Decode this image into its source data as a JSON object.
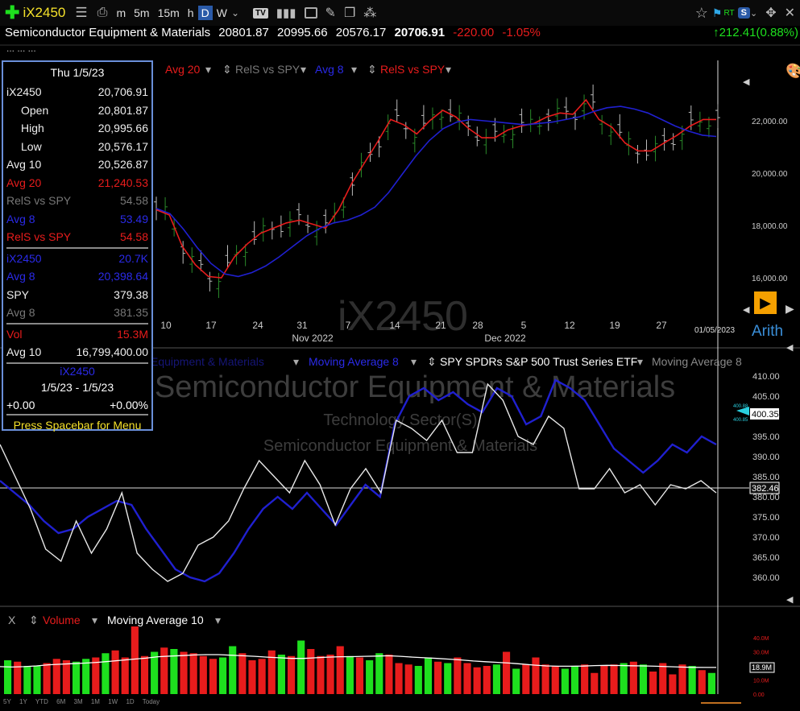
{
  "toolbar": {
    "symbol": "iX2450",
    "periods": [
      "m",
      "5m",
      "15m",
      "h",
      "D",
      "W"
    ],
    "selected": "D"
  },
  "header": {
    "name": "Semiconductor Equipment & Materials",
    "open": "20801.87",
    "high": "20995.66",
    "low": "20576.17",
    "close": "20706.91",
    "change": "-220.00",
    "change_pct": "-1.05%",
    "right_change": "212.41",
    "right_pct": "(0.88%)",
    "rt": "RT",
    "s_badge": "S"
  },
  "dots": "... ... ...",
  "panel": {
    "date": "Thu 1/5/23",
    "rows": [
      {
        "label": "iX2450",
        "value": "20,706.91",
        "color": "white"
      },
      {
        "label": "Open",
        "value": "20,801.87",
        "color": "white",
        "indent": true
      },
      {
        "label": "High",
        "value": "20,995.66",
        "color": "white",
        "indent": true
      },
      {
        "label": "Low",
        "value": "20,576.17",
        "color": "white",
        "indent": true
      },
      {
        "label": "Avg 10",
        "value": "20,526.87",
        "color": "white"
      },
      {
        "label": "Avg 20",
        "value": "21,240.53",
        "color": "red"
      },
      {
        "label": "RelS vs SPY",
        "value": "54.58",
        "color": "gray"
      },
      {
        "label": "Avg 8",
        "value": "53.49",
        "color": "blue"
      },
      {
        "label": "RelS vs SPY",
        "value": "54.58",
        "color": "red"
      }
    ],
    "rows2": [
      {
        "label": "iX2450",
        "value": "20.7K",
        "color": "blue"
      },
      {
        "label": "Avg 8",
        "value": "20,398.64",
        "color": "blue"
      },
      {
        "label": "SPY",
        "value": "379.38",
        "color": "white"
      },
      {
        "label": "Avg 8",
        "value": "381.35",
        "color": "gray"
      }
    ],
    "rows3": [
      {
        "label": "Vol",
        "value": "15.3M",
        "color": "red"
      },
      {
        "label": "Avg 10",
        "value": "16,799,400.00",
        "color": "white"
      }
    ],
    "sym2": "iX2450",
    "range": "1/5/23 - 1/5/23",
    "chg": "+0.00",
    "chgpct": "+0.00%",
    "menu": "Press Spacebar for Menu"
  },
  "main_legend": {
    "avg20": "Avg 20",
    "rels": "RelS vs SPY",
    "avg8": "Avg 8",
    "rels2": "RelS vs SPY"
  },
  "watermark": "iX2450",
  "arith": "Arith",
  "x_labels": [
    "10",
    "17",
    "24",
    "31",
    "7",
    "14",
    "21",
    "28",
    "5",
    "12",
    "19",
    "27"
  ],
  "month_labels": [
    "Nov 2022",
    "Dec 2022"
  ],
  "date_tag": "01/05/2023",
  "y_main": [
    "22,000.00",
    "20,000.00",
    "18,000.00",
    "16,000.00"
  ],
  "mid_legend": {
    "a": "Equipment & Materials",
    "b": "Moving Average 8",
    "c": "SPY SPDRs S&P 500 Trust Series ETF",
    "d": "Moving Average 8"
  },
  "mid_watermark": {
    "a": "Semiconductor Equipment & Materials",
    "b": "Technology Sector(S)",
    "c": "Semiconductor Equipment & Materials"
  },
  "y_mid": [
    "410.00",
    "405.00",
    "400.00",
    "395.00",
    "390.00",
    "385.00",
    "380.00",
    "375.00",
    "370.00",
    "365.00",
    "360.00"
  ],
  "mid_tag": "400.35",
  "mid_tag2": "382.46",
  "mid_tick_a": "400.88",
  "mid_tick_b": "400.85",
  "vol_legend": {
    "x": "X",
    "vol": "Volume",
    "ma": "Moving Average 10"
  },
  "y_vol": [
    "40.0M",
    "30.0M",
    "20.0M",
    "10.0M",
    "0.00"
  ],
  "vol_tag": "18.9M",
  "timeframes": [
    "5Y",
    "1Y",
    "YTD",
    "6M",
    "3M",
    "1M",
    "1W",
    "1D",
    "Today"
  ],
  "colors": {
    "up": "#1ee01e",
    "down": "#e81c1c",
    "ma_red": "#e81c1c",
    "ma_blue": "#2020d0",
    "spy": "#e8e8e8"
  },
  "chart_data": {
    "type": "line",
    "mid_y_range": [
      357,
      412
    ],
    "price_ohlc_bars": 64,
    "price_avg20": [
      18600,
      18400,
      17200,
      16500,
      16050,
      16000,
      16800,
      17300,
      17700,
      17900,
      18100,
      18200,
      18050,
      17900,
      18600,
      19600,
      20400,
      21200,
      22050,
      21850,
      21500,
      22000,
      22400,
      22150,
      21700,
      21350,
      21350,
      21650,
      21800,
      21900,
      22150,
      22300,
      22250,
      22800,
      22050,
      21750,
      21150,
      20850,
      20850,
      21150,
      21450,
      21800,
      22050,
      22050
    ],
    "price_avg8": [
      18650,
      18450,
      17850,
      17150,
      16550,
      16150,
      16050,
      16200,
      16450,
      16800,
      17200,
      17600,
      17900,
      18100,
      18200,
      18400,
      18700,
      19250,
      19950,
      20650,
      21250,
      21700,
      21950,
      22050,
      22000,
      21950,
      21900,
      21850,
      21900,
      21950,
      22050,
      22150,
      22350,
      22500,
      22550,
      22450,
      22300,
      22050,
      21800,
      21600,
      21450,
      21400
    ],
    "mid_ix_ma8": [
      384,
      381,
      378,
      374,
      371,
      372,
      375,
      377,
      379,
      378,
      372,
      367,
      362,
      360,
      359,
      361,
      366,
      372,
      377,
      380,
      377,
      381,
      377,
      373,
      378,
      383,
      380,
      398,
      405,
      407,
      404,
      406,
      403,
      401,
      407,
      405,
      398,
      400,
      409,
      407,
      404,
      398,
      392,
      389,
      386,
      389,
      393,
      391,
      395,
      393
    ],
    "mid_spy": [
      393,
      385,
      377,
      367,
      364,
      374,
      366,
      372,
      381,
      366,
      362,
      359,
      361,
      368,
      370,
      374,
      382,
      389,
      385,
      381,
      389,
      383,
      373,
      382,
      387,
      381,
      399,
      397,
      394,
      399,
      391,
      391,
      408,
      404,
      395,
      393,
      400,
      397,
      382,
      382,
      387,
      381,
      383,
      378,
      383,
      382,
      384,
      381
    ],
    "volume": [
      24,
      23,
      20,
      20,
      22,
      25,
      24,
      23,
      25,
      26,
      29,
      31,
      26,
      48,
      27,
      30,
      33,
      32,
      30,
      29,
      27,
      25,
      26,
      34,
      29,
      24,
      25,
      31,
      28,
      27,
      38,
      32,
      27,
      28,
      34,
      27,
      26,
      24,
      29,
      28,
      22,
      21,
      20,
      26,
      23,
      22,
      26,
      22,
      19,
      20,
      21,
      30,
      18,
      21,
      26,
      21,
      20,
      18,
      20,
      21,
      15,
      20,
      21,
      22,
      23,
      21,
      16,
      22,
      14,
      21,
      20,
      17,
      15
    ],
    "vol_ma10": [
      19.5,
      19.2,
      19.5,
      20.0,
      20.8,
      21.2,
      21.6,
      22.0,
      22.5,
      23.2,
      24.0,
      24.8,
      25.5,
      26.5,
      27.0,
      27.3,
      27.8,
      28.0,
      28.0,
      27.6,
      27.2,
      26.8,
      26.2,
      25.8,
      25.3,
      25.3,
      25.8,
      26.2,
      26.5,
      26.6,
      26.8,
      27.0,
      27.2,
      26.8,
      26.2,
      25.8,
      25.3,
      24.8,
      24.2,
      23.5,
      23.0,
      22.5,
      22.0,
      21.3,
      20.6,
      20.0,
      19.8,
      19.8,
      19.9,
      20.2,
      20.4,
      20.3,
      20.1,
      20.0,
      19.8,
      19.5,
      19.2,
      19.0,
      18.9,
      18.9
    ]
  }
}
